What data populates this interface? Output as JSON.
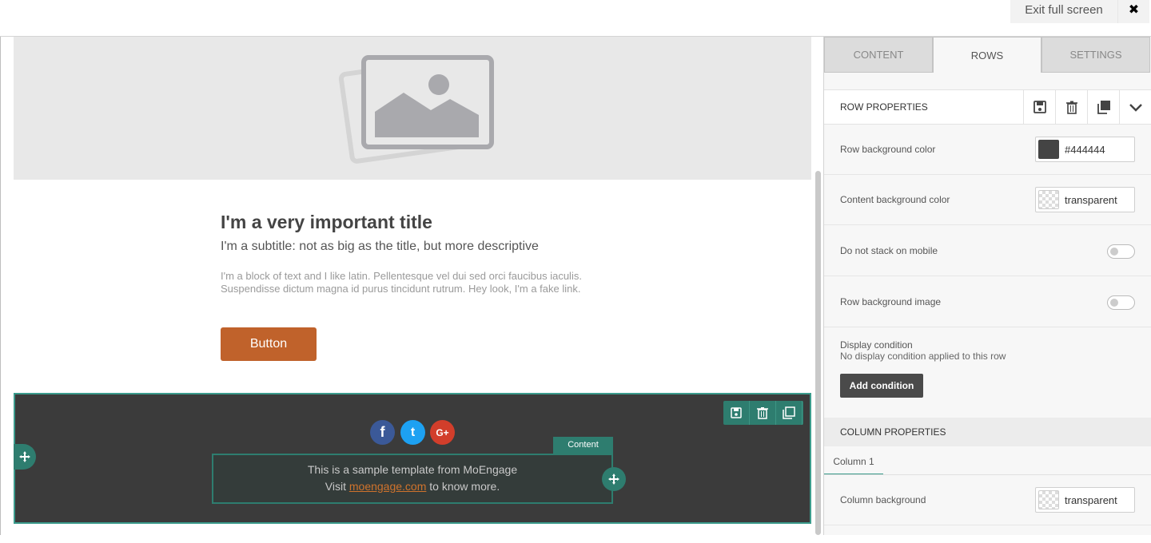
{
  "topbar": {
    "exit_label": "Exit full screen",
    "close_label": "✖"
  },
  "canvas": {
    "title": "I'm a very important title",
    "subtitle": "I'm a subtitle: not as big as the title, but more descriptive",
    "body": "I'm a block of text and I like latin. Pellentesque vel dui sed orci faucibus iaculis. Suspendisse dictum magna id purus tincidunt rutrum. Hey look, I'm a fake link.",
    "button_label": "Button",
    "content_tag": "Content",
    "footer_line1": "This is a sample template from MoEngage",
    "footer_line2_pre": "Visit ",
    "footer_link": "moengage.com",
    "footer_line2_post": " to know more.",
    "social": [
      {
        "icon": "facebook-icon",
        "glyph": "f",
        "color": "#3b5998"
      },
      {
        "icon": "twitter-icon",
        "glyph": "t",
        "color": "#1da1f2"
      },
      {
        "icon": "google-plus-icon",
        "glyph": "G+",
        "color": "#d23e2b"
      }
    ]
  },
  "panel": {
    "tabs": [
      "CONTENT",
      "ROWS",
      "SETTINGS"
    ],
    "active_tab": "ROWS",
    "row_properties_title": "ROW PROPERTIES",
    "row_bg_label": "Row background color",
    "row_bg_value": "#444444",
    "row_bg_swatch": "#444444",
    "content_bg_label": "Content background color",
    "content_bg_value": "transparent",
    "stack_label": "Do not stack on mobile",
    "bg_image_label": "Row background image",
    "display_condition_label": "Display condition",
    "display_condition_desc": "No display condition applied to this row",
    "add_condition_label": "Add condition",
    "column_properties_title": "COLUMN PROPERTIES",
    "column_tab": "Column 1",
    "column_bg_label": "Column background",
    "column_bg_value": "transparent"
  }
}
